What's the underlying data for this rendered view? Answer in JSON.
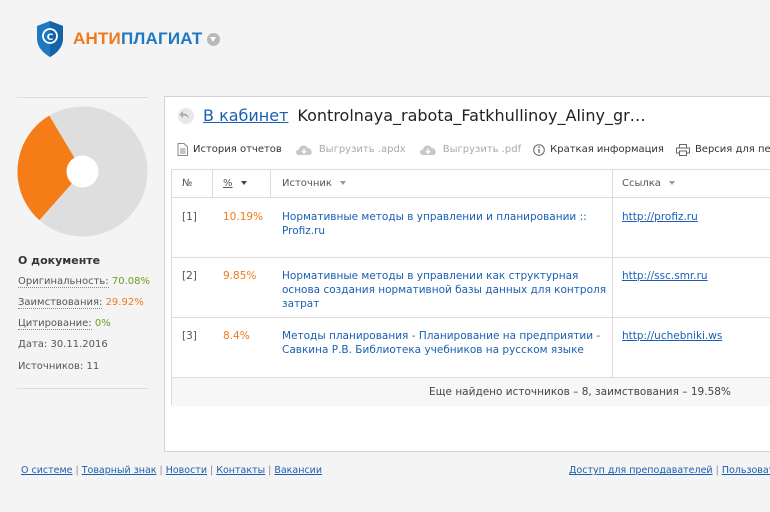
{
  "brand": {
    "part1": "АНТИ",
    "part2": "ПЛАГИАТ"
  },
  "colors": {
    "orange": "#f07a1a",
    "blue": "#1a5fb4",
    "green": "#6aa01e",
    "pie_bg": "#dedede"
  },
  "document": {
    "heading": "О документе",
    "originality_label": "Оригинальность:",
    "originality_value": "70.08%",
    "borrowing_label": "Заимствования:",
    "borrowing_value": "29.92%",
    "citation_label": "Цитирование:",
    "citation_value": "0%",
    "date_label": "Дата:",
    "date_value": "30.11.2016",
    "sources_label": "Источников:",
    "sources_value": "11",
    "originality_fraction": 0.7008,
    "borrowing_fraction": 0.2992
  },
  "header": {
    "back_link": "В кабинет",
    "file_name": "Kontrolnaya_rabota_Fatkhullinoy_Aliny_gr…"
  },
  "toolbar": {
    "history": "История отчетов",
    "export_apdx": "Выгрузить .apdx",
    "export_pdf": "Выгрузить .pdf",
    "brief_info": "Краткая информация",
    "print_version": "Версия для печа"
  },
  "table": {
    "columns": {
      "num": "№",
      "pct": "%",
      "source": "Источник",
      "link": "Ссылка"
    },
    "rows": [
      {
        "num": "[1]",
        "pct": "10.19%",
        "source": "Нормативные методы в управлении и планировании :: Profiz.ru",
        "link": "http://profiz.ru"
      },
      {
        "num": "[2]",
        "pct": "9.85%",
        "source": "Нормативные методы в управлении как структурная основа создания нормативной базы данных для контроля затрат",
        "link": "http://ssc.smr.ru"
      },
      {
        "num": "[3]",
        "pct": "8.4%",
        "source": "Методы планирования - Планирование на предприятии - Савкина Р.В. Библиотека учебников на русском языке",
        "link": "http://uchebniki.ws"
      }
    ],
    "summary": "Еще найдено источников – 8, заимствования – 19.58%"
  },
  "footer": {
    "links": [
      "О системе",
      "Товарный знак",
      "Новости",
      "Контакты",
      "Вакансии"
    ],
    "right_links": [
      "Доступ для преподавателей",
      "Пользоват"
    ]
  }
}
